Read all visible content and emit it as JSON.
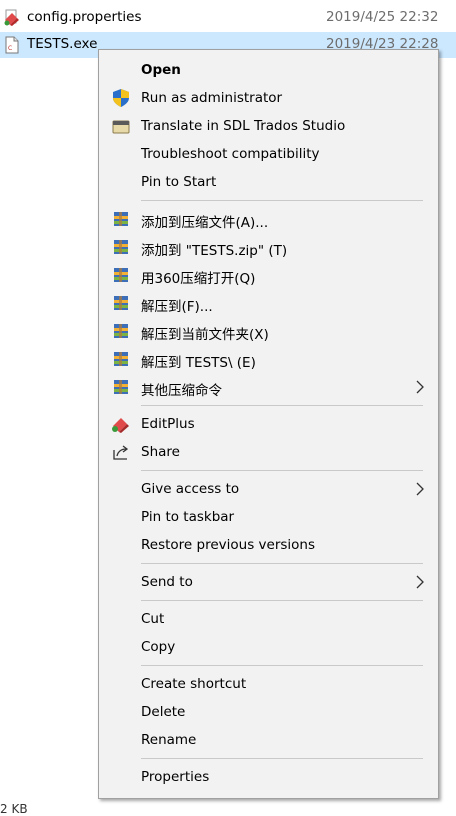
{
  "files": [
    {
      "name": "config.properties",
      "date": "2019/4/25 22:32"
    },
    {
      "name": "TESTS.exe",
      "date": "2019/4/23 22:28"
    }
  ],
  "size_fragment": "2 KB",
  "menu": {
    "items": [
      {
        "label": "Open",
        "icon": "none"
      },
      {
        "label": "Run as administrator",
        "icon": "shield-icon"
      },
      {
        "label": "Translate in SDL Trados Studio",
        "icon": "trados-icon"
      },
      {
        "label": "Troubleshoot compatibility",
        "icon": "none"
      },
      {
        "label": "Pin to Start",
        "icon": "none"
      },
      {
        "label": "添加到压缩文件(A)...",
        "icon": "archive-icon"
      },
      {
        "label": "添加到 \"TESTS.zip\" (T)",
        "icon": "archive-icon"
      },
      {
        "label": "用360压缩打开(Q)",
        "icon": "archive-icon"
      },
      {
        "label": "解压到(F)...",
        "icon": "archive-icon"
      },
      {
        "label": "解压到当前文件夹(X)",
        "icon": "archive-icon"
      },
      {
        "label": "解压到 TESTS\\ (E)",
        "icon": "archive-icon"
      },
      {
        "label": "其他压缩命令",
        "icon": "archive-icon",
        "submenu": true
      },
      {
        "label": "EditPlus",
        "icon": "editplus-icon"
      },
      {
        "label": "Share",
        "icon": "share-icon"
      },
      {
        "label": "Give access to",
        "submenu": true
      },
      {
        "label": "Pin to taskbar"
      },
      {
        "label": "Restore previous versions"
      },
      {
        "label": "Send to",
        "submenu": true
      },
      {
        "label": "Cut"
      },
      {
        "label": "Copy"
      },
      {
        "label": "Create shortcut"
      },
      {
        "label": "Delete"
      },
      {
        "label": "Rename"
      },
      {
        "label": "Properties"
      }
    ]
  },
  "colors": {
    "selection": "#cce8ff",
    "menu_bg": "#f2f2f2",
    "separator": "#c9c9c9"
  }
}
